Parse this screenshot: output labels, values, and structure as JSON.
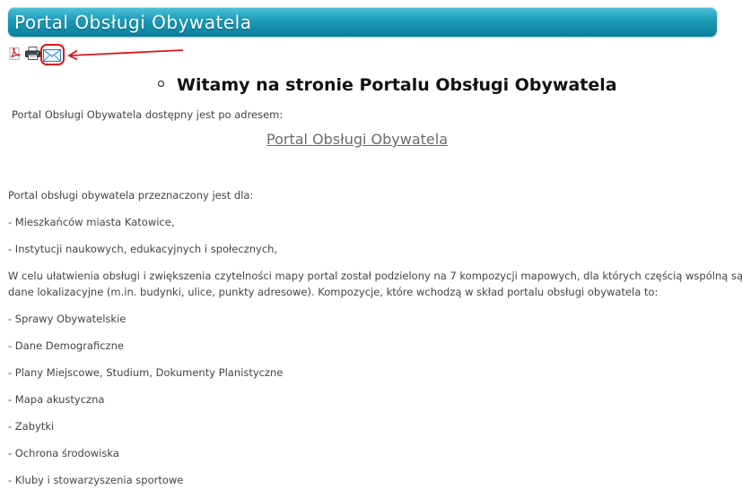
{
  "header": {
    "title": "Portal Obsługi Obywatela"
  },
  "toolbar": {
    "icons": [
      "pdf-icon",
      "print-icon",
      "email-icon"
    ],
    "highlight_color": "#e0141b"
  },
  "content": {
    "heading": "Witamy na stronie Portalu Obsługi Obywatela",
    "intro": "Portal Obsługi Obywatela dostępny jest po adresem:",
    "link_text": "Portal Obsługi Obywatela",
    "purpose": "Portal obsługi obywatela przeznaczony jest dla:",
    "audience": [
      "- Mieszkańców miasta Katowice,",
      "- Instytucji naukowych, edukacyjnych i społecznych,"
    ],
    "description_line1": "W celu ułatwienia obsługi i zwiększenia czytelności mapy portal został podzielony na 7 kompozycji mapowych, dla których częścią wspólną są",
    "description_line2": "dane lokalizacyjne (m.in. budynki, ulice, punkty adresowe). Kompozycje, które wchodzą w skład portalu obsługi obywatela to:",
    "compositions": [
      "- Sprawy Obywatelskie",
      "- Dane Demograficzne",
      "- Plany Miejscowe, Studium, Dokumenty Planistyczne",
      "- Mapa akustyczna",
      "- Zabytki",
      "- Ochrona środowiska",
      "- Kluby i stowarzyszenia sportowe"
    ]
  },
  "colors": {
    "title_bar": "#1b9ab7",
    "body_text": "#444444",
    "link": "#6b6b6b"
  }
}
